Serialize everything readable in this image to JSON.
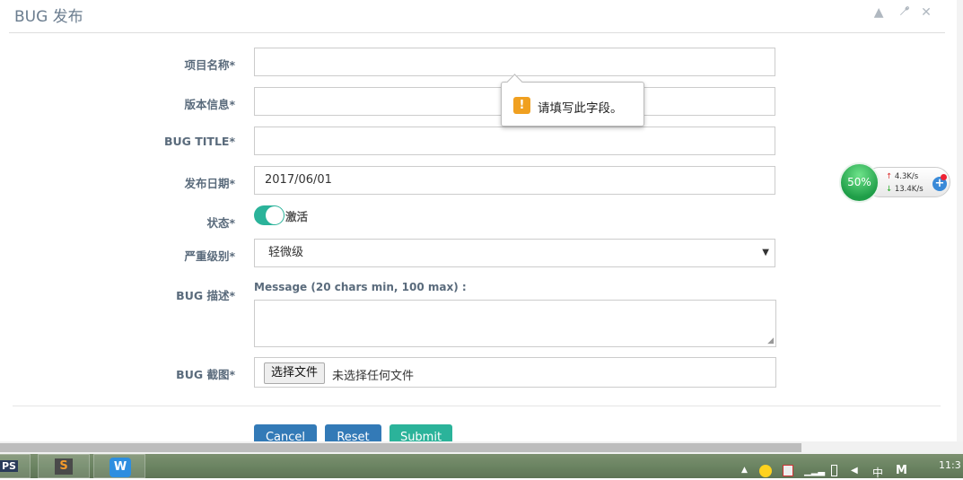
{
  "panel": {
    "title": "BUG 发布",
    "tools": {
      "collapse": "▲",
      "settings": "⚙",
      "close": "✕"
    }
  },
  "form": {
    "project_name": {
      "label": "项目名称*",
      "value": ""
    },
    "version": {
      "label": "版本信息*",
      "value": ""
    },
    "bug_title": {
      "label": "BUG TITLE*",
      "value": ""
    },
    "release_date": {
      "label": "发布日期*",
      "value": "2017/06/01"
    },
    "status": {
      "label": "状态*",
      "toggle_label": "激活",
      "on": true
    },
    "severity": {
      "label": "严重级别*",
      "selected": "轻微级"
    },
    "description": {
      "label": "BUG 描述*",
      "hint": "Message (20 chars min, 100 max) :"
    },
    "screenshot": {
      "label": "BUG 截图*",
      "button": "选择文件",
      "no_file": "未选择任何文件"
    }
  },
  "tooltip": {
    "icon": "!",
    "text": "请填写此字段。"
  },
  "buttons": {
    "cancel": "Cancel",
    "reset": "Reset",
    "submit": "Submit"
  },
  "net_widget": {
    "percent": "50%",
    "up": "4.3K/s",
    "down": "13.4K/s"
  },
  "taskbar": {
    "app1": "PS",
    "app2": "S",
    "app3": "W",
    "clock": "11:3",
    "ime": "中",
    "ime2": "M"
  },
  "colors": {
    "accent": "#2bb39a",
    "primary": "#337ab7",
    "warning": "#f0a020"
  }
}
